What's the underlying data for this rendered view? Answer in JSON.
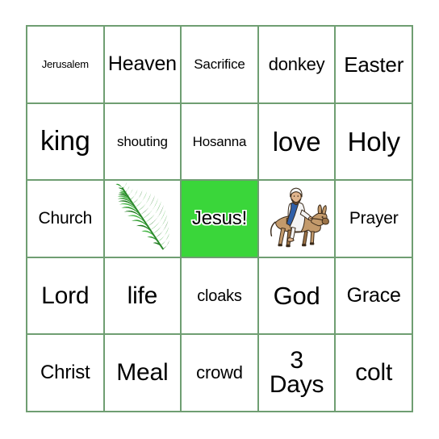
{
  "card": {
    "type": "bingo-card",
    "rows": 5,
    "columns": 5,
    "border_color": "#6f9e72",
    "background_color": "#ffffff",
    "marked_color": "#3ad63a",
    "cells": [
      [
        {
          "text": "Jerusalem",
          "font_size": 13,
          "kind": "text"
        },
        {
          "text": "Heaven",
          "font_size": 25,
          "kind": "text"
        },
        {
          "text": "Sacrifice",
          "font_size": 17,
          "kind": "text"
        },
        {
          "text": "donkey",
          "font_size": 22,
          "kind": "text"
        },
        {
          "text": "Easter",
          "font_size": 26,
          "kind": "text"
        }
      ],
      [
        {
          "text": "king",
          "font_size": 34,
          "kind": "text"
        },
        {
          "text": "shouting",
          "font_size": 17,
          "kind": "text"
        },
        {
          "text": "Hosanna",
          "font_size": 17,
          "kind": "text"
        },
        {
          "text": "love",
          "font_size": 33,
          "kind": "text"
        },
        {
          "text": "Holy",
          "font_size": 33,
          "kind": "text"
        }
      ],
      [
        {
          "text": "Church",
          "font_size": 21,
          "kind": "text"
        },
        {
          "text": "",
          "font_size": 0,
          "kind": "image",
          "image": "palm-branch-image"
        },
        {
          "text": "Jesus!",
          "font_size": 24,
          "kind": "text",
          "marked": true
        },
        {
          "text": "",
          "font_size": 0,
          "kind": "image",
          "image": "jesus-riding-donkey-image"
        },
        {
          "text": "Prayer",
          "font_size": 21,
          "kind": "text"
        }
      ],
      [
        {
          "text": "Lord",
          "font_size": 30,
          "kind": "text"
        },
        {
          "text": "life",
          "font_size": 30,
          "kind": "text"
        },
        {
          "text": "cloaks",
          "font_size": 20,
          "kind": "text"
        },
        {
          "text": "God",
          "font_size": 31,
          "kind": "text"
        },
        {
          "text": "Grace",
          "font_size": 25,
          "kind": "text"
        }
      ],
      [
        {
          "text": "Christ",
          "font_size": 24,
          "kind": "text"
        },
        {
          "text": "Meal",
          "font_size": 30,
          "kind": "text"
        },
        {
          "text": "crowd",
          "font_size": 22,
          "kind": "text"
        },
        {
          "text": "3\nDays",
          "font_size": 30,
          "kind": "text"
        },
        {
          "text": "colt",
          "font_size": 30,
          "kind": "text"
        }
      ]
    ]
  },
  "images": {
    "palm_branch": {
      "name": "palm-branch-image",
      "description": "green palm frond",
      "colors": {
        "dark": "#1f7a1f",
        "mid": "#2e9b2e",
        "light": "#46b646",
        "stem": "#2a8a2a"
      }
    },
    "jesus_donkey": {
      "name": "jesus-riding-donkey-image",
      "description": "Jesus in white robe with blue sash riding a brown donkey",
      "colors": {
        "robe": "#f4f4f4",
        "sash": "#2f5fa8",
        "donkey_body": "#c39a6b",
        "donkey_shade": "#9c7347",
        "skin": "#e0b48c",
        "hair": "#6b4a2f",
        "outline": "#3a2a1a"
      }
    }
  }
}
